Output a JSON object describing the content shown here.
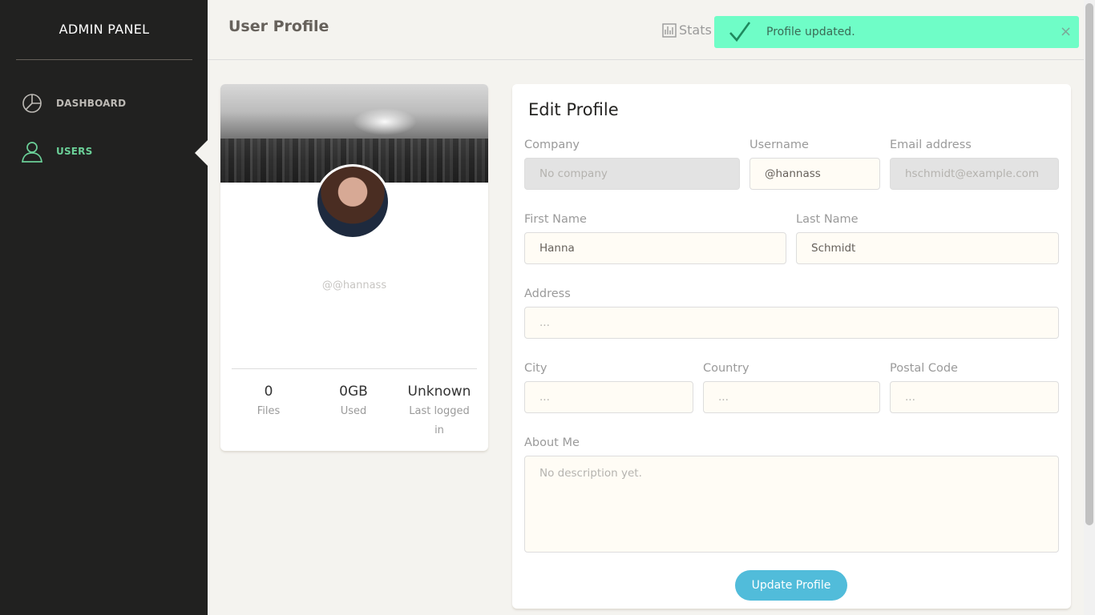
{
  "sidebar": {
    "brand": "ADMIN PANEL",
    "items": [
      {
        "label": "DASHBOARD",
        "icon": "pie-chart-icon",
        "active": false
      },
      {
        "label": "USERS",
        "icon": "user-icon",
        "active": true
      }
    ]
  },
  "header": {
    "title": "User Profile",
    "stats_label": "Stats"
  },
  "notification": {
    "message": "Profile updated.",
    "icon": "check-icon",
    "close_icon": "close-icon",
    "color": "#6ffdc7"
  },
  "profile": {
    "handle": "@@hannass",
    "stats": [
      {
        "value": "0",
        "caption": "Files"
      },
      {
        "value": "0GB",
        "caption": "Used"
      },
      {
        "value": "Unknown",
        "caption": "Last logged in"
      }
    ]
  },
  "form": {
    "title": "Edit Profile",
    "company": {
      "label": "Company",
      "value": "",
      "placeholder": "No company"
    },
    "username": {
      "label": "Username",
      "value": "@hannass",
      "placeholder": ""
    },
    "email": {
      "label": "Email address",
      "value": "",
      "placeholder": "hschmidt@example.com"
    },
    "first_name": {
      "label": "First Name",
      "value": "Hanna",
      "placeholder": ""
    },
    "last_name": {
      "label": "Last Name",
      "value": "Schmidt",
      "placeholder": ""
    },
    "address": {
      "label": "Address",
      "value": "",
      "placeholder": "..."
    },
    "city": {
      "label": "City",
      "value": "",
      "placeholder": "..."
    },
    "country": {
      "label": "Country",
      "value": "",
      "placeholder": "..."
    },
    "postal_code": {
      "label": "Postal Code",
      "value": "",
      "placeholder": "..."
    },
    "about": {
      "label": "About Me",
      "value": "",
      "placeholder": "No description yet."
    },
    "submit_label": "Update Profile"
  },
  "colors": {
    "sidebar_bg": "#212120",
    "accent_green": "#6bd098",
    "button_blue": "#51bcda",
    "page_bg": "#f4f3ef"
  }
}
